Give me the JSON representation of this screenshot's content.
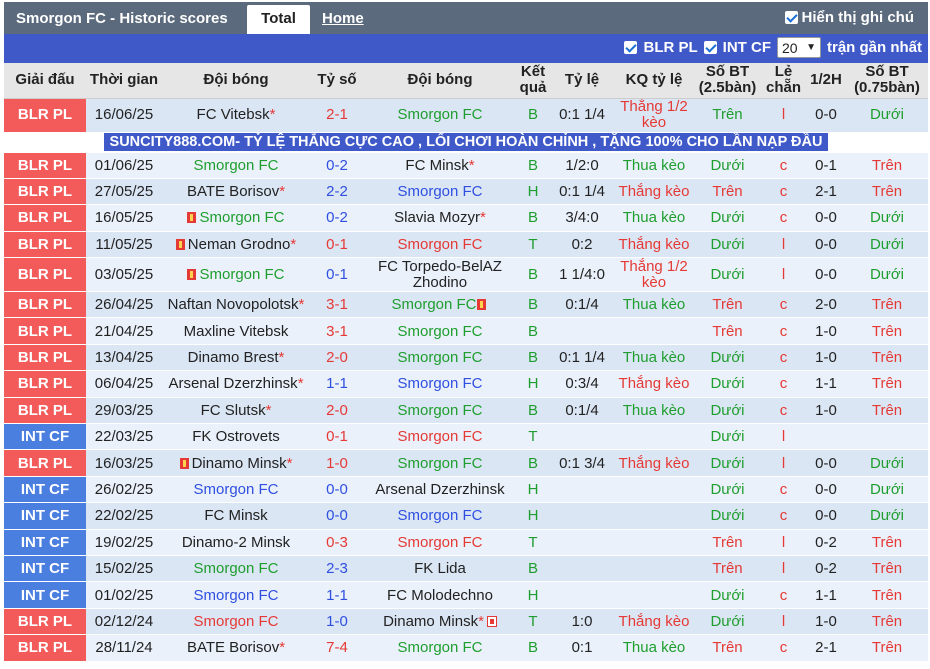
{
  "header": {
    "title": "Smorgon FC - Historic scores",
    "tab_total": "Total",
    "tab_home": "Home",
    "show_vn": "Hiển thị ghi chú"
  },
  "filters": {
    "blr": "BLR PL",
    "int": "INT CF",
    "count": "20",
    "count_label": "trận gần nhất"
  },
  "columns": [
    "Giải đấu",
    "Thời gian",
    "Đội bóng",
    "Tỷ số",
    "Đội bóng",
    "Kết quả",
    "Tỷ lệ",
    "KQ tỷ lệ",
    "Số BT (2.5bàn)",
    "Lẻ chẵn",
    "1/2H",
    "Số BT (0.75bàn)"
  ],
  "ad_text": "SUNCITY888.COM- TỶ LỆ THẮNG CỰC CAO , LỐI CHƠI HOÀN CHỈNH , TẶNG 100% CHO LẦN NẠP ĐẦU",
  "colors": {
    "red": "#e53935",
    "green": "#1e9e2e",
    "blue": "#2f4fe0",
    "blr": "#f35b5b",
    "int": "#4a7fe0"
  },
  "rows": [
    {
      "league": "BLR PL",
      "date": "16/06/25",
      "home": "FC Vitebsk",
      "score": "2-1",
      "away": "Smorgon FC",
      "res": "B",
      "odds": "0:1 1/4",
      "kq": "Thắng 1/2 kèo",
      "bt": "Trên",
      "lc": "l",
      "h": "0-0",
      "bt2": "Dưới",
      "tall": true,
      "hstar": true,
      "hc": "",
      "sc": "red",
      "ac": "green",
      "kqc": "red",
      "btc": "green",
      "b2c": "green"
    },
    {
      "league": "BLR PL",
      "date": "01/06/25",
      "home": "Smorgon FC",
      "score": "0-2",
      "away": "FC Minsk",
      "res": "B",
      "odds": "1/2:0",
      "kq": "Thua kèo",
      "bt": "Dưới",
      "lc": "c",
      "h": "0-1",
      "bt2": "Trên",
      "astar": true,
      "hc": "green",
      "sc": "blue",
      "ac": "",
      "kqc": "green",
      "btc": "green",
      "b2c": "red"
    },
    {
      "league": "BLR PL",
      "date": "27/05/25",
      "home": "BATE Borisov",
      "score": "2-2",
      "away": "Smorgon FC",
      "res": "H",
      "odds": "0:1 1/4",
      "kq": "Thắng kèo",
      "bt": "Trên",
      "lc": "c",
      "h": "2-1",
      "bt2": "Trên",
      "hstar": true,
      "hc": "",
      "sc": "blue",
      "ac": "blue",
      "kqc": "red",
      "btc": "red",
      "b2c": "red"
    },
    {
      "league": "BLR PL",
      "date": "16/05/25",
      "home": "Smorgon FC",
      "score": "0-2",
      "away": "Slavia Mozyr",
      "res": "B",
      "odds": "3/4:0",
      "kq": "Thua kèo",
      "bt": "Dưới",
      "lc": "c",
      "h": "0-0",
      "bt2": "Dưới",
      "hflag": true,
      "astar": true,
      "hc": "green",
      "sc": "blue",
      "ac": "",
      "kqc": "green",
      "btc": "green",
      "b2c": "green"
    },
    {
      "league": "BLR PL",
      "date": "11/05/25",
      "home": "Neman Grodno",
      "score": "0-1",
      "away": "Smorgon FC",
      "res": "T",
      "odds": "0:2",
      "kq": "Thắng kèo",
      "bt": "Dưới",
      "lc": "l",
      "h": "0-0",
      "bt2": "Dưới",
      "hflag": true,
      "hstar": true,
      "hc": "",
      "sc": "red",
      "ac": "red",
      "kqc": "red",
      "btc": "green",
      "b2c": "green"
    },
    {
      "league": "BLR PL",
      "date": "03/05/25",
      "home": "Smorgon FC",
      "score": "0-1",
      "away": "FC Torpedo-BelAZ Zhodino",
      "res": "B",
      "odds": "1 1/4:0",
      "kq": "Thắng 1/2 kèo",
      "bt": "Dưới",
      "lc": "l",
      "h": "0-0",
      "bt2": "Dưới",
      "tall": true,
      "hflag": true,
      "hc": "green",
      "sc": "blue",
      "ac": "",
      "kqc": "red",
      "btc": "green",
      "b2c": "green"
    },
    {
      "league": "BLR PL",
      "date": "26/04/25",
      "home": "Naftan Novopolotsk",
      "score": "3-1",
      "away": "Smorgon FC",
      "res": "B",
      "odds": "0:1/4",
      "kq": "Thua kèo",
      "bt": "Trên",
      "lc": "c",
      "h": "2-0",
      "bt2": "Trên",
      "hstar": true,
      "aflag": true,
      "hc": "",
      "sc": "red",
      "ac": "green",
      "kqc": "green",
      "btc": "red",
      "b2c": "red"
    },
    {
      "league": "BLR PL",
      "date": "21/04/25",
      "home": "Maxline Vitebsk",
      "score": "3-1",
      "away": "Smorgon FC",
      "res": "B",
      "odds": "",
      "kq": "",
      "bt": "Trên",
      "lc": "c",
      "h": "1-0",
      "bt2": "Trên",
      "hc": "",
      "sc": "red",
      "ac": "green",
      "kqc": "",
      "btc": "red",
      "b2c": "red"
    },
    {
      "league": "BLR PL",
      "date": "13/04/25",
      "home": "Dinamo Brest",
      "score": "2-0",
      "away": "Smorgon FC",
      "res": "B",
      "odds": "0:1 1/4",
      "kq": "Thua kèo",
      "bt": "Dưới",
      "lc": "c",
      "h": "1-0",
      "bt2": "Trên",
      "hstar": true,
      "hc": "",
      "sc": "red",
      "ac": "green",
      "kqc": "green",
      "btc": "green",
      "b2c": "red"
    },
    {
      "league": "BLR PL",
      "date": "06/04/25",
      "home": "Arsenal Dzerzhinsk",
      "score": "1-1",
      "away": "Smorgon FC",
      "res": "H",
      "odds": "0:3/4",
      "kq": "Thắng kèo",
      "bt": "Dưới",
      "lc": "c",
      "h": "1-1",
      "bt2": "Trên",
      "hstar": true,
      "hc": "",
      "sc": "blue",
      "ac": "blue",
      "kqc": "red",
      "btc": "green",
      "b2c": "red"
    },
    {
      "league": "BLR PL",
      "date": "29/03/25",
      "home": "FC Slutsk",
      "score": "2-0",
      "away": "Smorgon FC",
      "res": "B",
      "odds": "0:1/4",
      "kq": "Thua kèo",
      "bt": "Dưới",
      "lc": "c",
      "h": "1-0",
      "bt2": "Trên",
      "hstar": true,
      "hc": "",
      "sc": "red",
      "ac": "green",
      "kqc": "green",
      "btc": "green",
      "b2c": "red"
    },
    {
      "league": "INT CF",
      "date": "22/03/25",
      "home": "FK Ostrovets",
      "score": "0-1",
      "away": "Smorgon FC",
      "res": "T",
      "odds": "",
      "kq": "",
      "bt": "Dưới",
      "lc": "l",
      "h": "",
      "bt2": "",
      "hc": "",
      "sc": "red",
      "ac": "red",
      "kqc": "",
      "btc": "green",
      "b2c": ""
    },
    {
      "league": "BLR PL",
      "date": "16/03/25",
      "home": "Dinamo Minsk",
      "score": "1-0",
      "away": "Smorgon FC",
      "res": "B",
      "odds": "0:1 3/4",
      "kq": "Thắng kèo",
      "bt": "Dưới",
      "lc": "l",
      "h": "0-0",
      "bt2": "Dưới",
      "hflag": true,
      "hstar": true,
      "hc": "",
      "sc": "red",
      "ac": "green",
      "kqc": "red",
      "btc": "green",
      "b2c": "green"
    },
    {
      "league": "INT CF",
      "date": "26/02/25",
      "home": "Smorgon FC",
      "score": "0-0",
      "away": "Arsenal Dzerzhinsk",
      "res": "H",
      "odds": "",
      "kq": "",
      "bt": "Dưới",
      "lc": "c",
      "h": "0-0",
      "bt2": "Dưới",
      "hc": "blue",
      "sc": "blue",
      "ac": "",
      "kqc": "",
      "btc": "green",
      "b2c": "green"
    },
    {
      "league": "INT CF",
      "date": "22/02/25",
      "home": "FC Minsk",
      "score": "0-0",
      "away": "Smorgon FC",
      "res": "H",
      "odds": "",
      "kq": "",
      "bt": "Dưới",
      "lc": "c",
      "h": "0-0",
      "bt2": "Dưới",
      "hc": "",
      "sc": "blue",
      "ac": "blue",
      "kqc": "",
      "btc": "green",
      "b2c": "green"
    },
    {
      "league": "INT CF",
      "date": "19/02/25",
      "home": "Dinamo-2 Minsk",
      "score": "0-3",
      "away": "Smorgon FC",
      "res": "T",
      "odds": "",
      "kq": "",
      "bt": "Trên",
      "lc": "l",
      "h": "0-2",
      "bt2": "Trên",
      "hc": "",
      "sc": "red",
      "ac": "red",
      "kqc": "",
      "btc": "red",
      "b2c": "red"
    },
    {
      "league": "INT CF",
      "date": "15/02/25",
      "home": "Smorgon FC",
      "score": "2-3",
      "away": "FK Lida",
      "res": "B",
      "odds": "",
      "kq": "",
      "bt": "Trên",
      "lc": "l",
      "h": "0-2",
      "bt2": "Trên",
      "hc": "green",
      "sc": "blue",
      "ac": "",
      "kqc": "",
      "btc": "red",
      "b2c": "red"
    },
    {
      "league": "INT CF",
      "date": "01/02/25",
      "home": "Smorgon FC",
      "score": "1-1",
      "away": "FC Molodechno",
      "res": "H",
      "odds": "",
      "kq": "",
      "bt": "Dưới",
      "lc": "c",
      "h": "1-1",
      "bt2": "Trên",
      "hc": "blue",
      "sc": "blue",
      "ac": "",
      "kqc": "",
      "btc": "green",
      "b2c": "red"
    },
    {
      "league": "BLR PL",
      "date": "02/12/24",
      "home": "Smorgon FC",
      "score": "1-0",
      "away": "Dinamo Minsk",
      "res": "T",
      "odds": "1:0",
      "kq": "Thắng kèo",
      "bt": "Dưới",
      "lc": "l",
      "h": "1-0",
      "bt2": "Trên",
      "astar": true,
      "aflag2": true,
      "hc": "red",
      "sc": "blue",
      "ac": "",
      "kqc": "red",
      "btc": "green",
      "b2c": "red"
    },
    {
      "league": "BLR PL",
      "date": "28/11/24",
      "home": "BATE Borisov",
      "score": "7-4",
      "away": "Smorgon FC",
      "res": "B",
      "odds": "0:1",
      "kq": "Thua kèo",
      "bt": "Trên",
      "lc": "c",
      "h": "2-1",
      "bt2": "Trên",
      "hstar": true,
      "hc": "",
      "sc": "red",
      "ac": "green",
      "kqc": "green",
      "btc": "red",
      "b2c": "red"
    }
  ]
}
